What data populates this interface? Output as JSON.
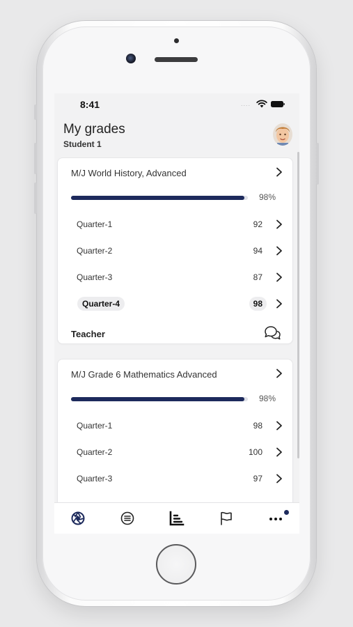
{
  "status_bar": {
    "time": "8:41",
    "signal": "....",
    "wifi_icon": "wifi-icon",
    "battery_icon": "battery-icon"
  },
  "header": {
    "title": "My grades",
    "subtitle": "Student 1",
    "avatar_icon": "user-avatar"
  },
  "courses": [
    {
      "name": "M/J World History, Advanced",
      "progress_percent": 98,
      "progress_label": "98%",
      "quarters": [
        {
          "label": "Quarter-1",
          "score": "92",
          "selected": false
        },
        {
          "label": "Quarter-2",
          "score": "94",
          "selected": false
        },
        {
          "label": "Quarter-3",
          "score": "87",
          "selected": false
        },
        {
          "label": "Quarter-4",
          "score": "98",
          "selected": true
        }
      ],
      "teacher_label": "Teacher",
      "teacher_icon": "chat-bubbles-icon"
    },
    {
      "name": "M/J Grade 6 Mathematics Advanced",
      "progress_percent": 98,
      "progress_label": "98%",
      "quarters": [
        {
          "label": "Quarter-1",
          "score": "98",
          "selected": false
        },
        {
          "label": "Quarter-2",
          "score": "100",
          "selected": false
        },
        {
          "label": "Quarter-3",
          "score": "97",
          "selected": false
        }
      ]
    }
  ],
  "tab_bar": {
    "tabs": [
      {
        "icon": "aperture-icon",
        "active": true
      },
      {
        "icon": "list-icon",
        "active": false
      },
      {
        "icon": "grades-chart-icon",
        "active": false
      },
      {
        "icon": "flag-icon",
        "active": false
      },
      {
        "icon": "more-icon",
        "active": false,
        "badge": true
      }
    ]
  },
  "colors": {
    "accent": "#1d2a5c",
    "progress_track": "#dfe1e8",
    "background": "#f2f2f3",
    "card": "#ffffff"
  }
}
